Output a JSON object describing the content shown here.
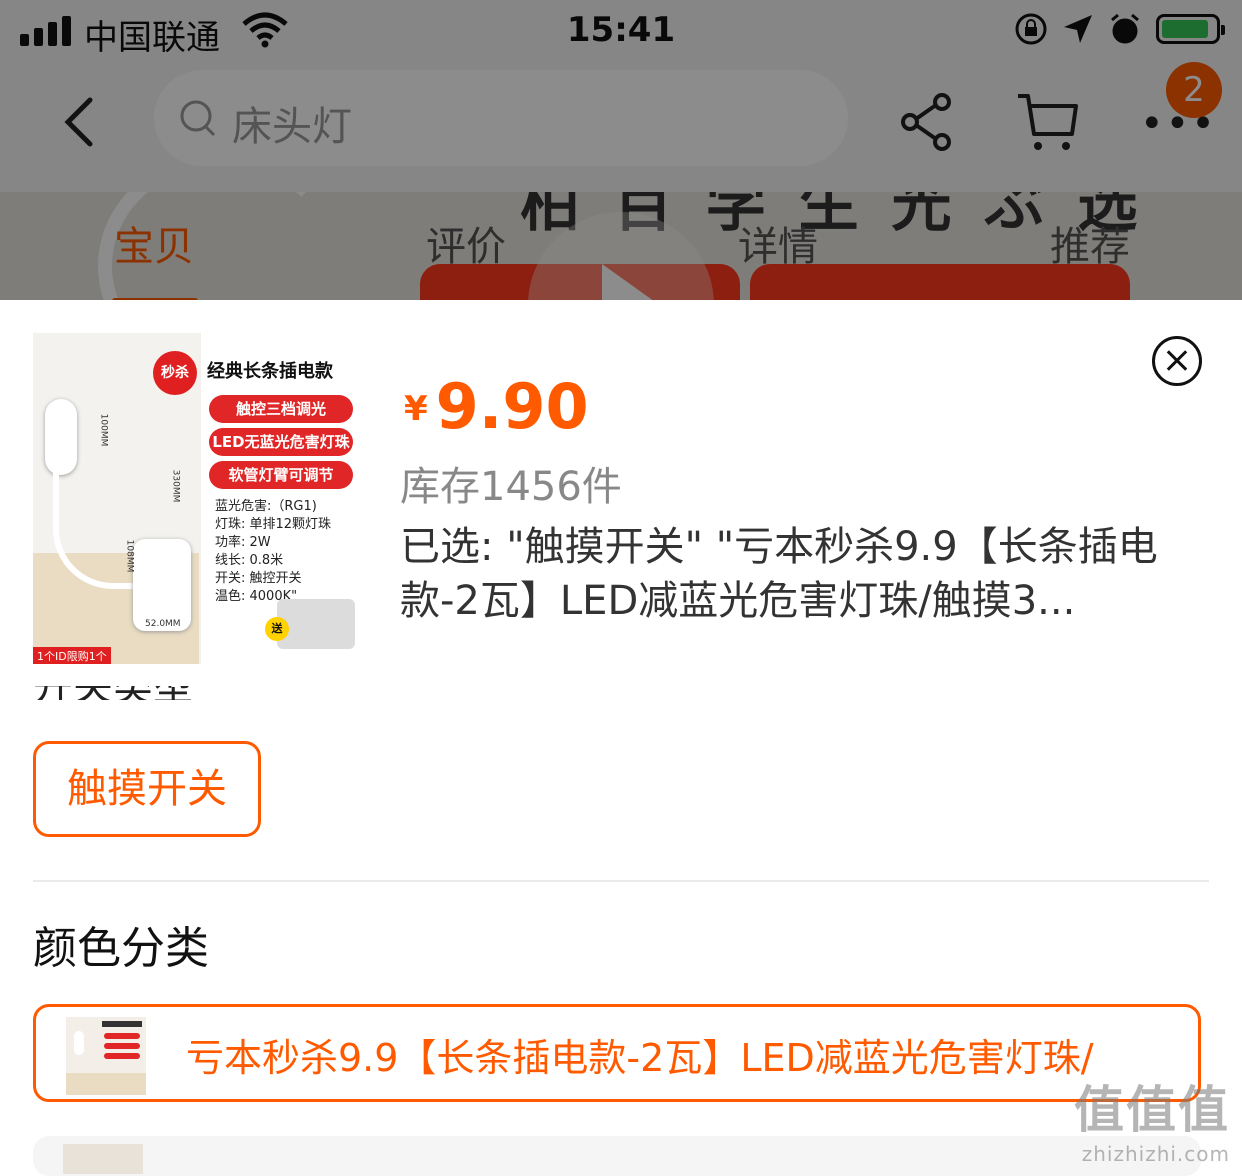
{
  "status_bar": {
    "carrier": "中国联通",
    "time": "15:41"
  },
  "nav": {
    "search_placeholder": "床头灯",
    "cart_badge": "2",
    "icons": [
      "back-arrow-icon",
      "search-icon",
      "share-icon",
      "cart-icon",
      "more-icon"
    ]
  },
  "tabs": [
    {
      "label": "宝贝",
      "active": true
    },
    {
      "label": "评价",
      "active": false
    },
    {
      "label": "详情",
      "active": false
    },
    {
      "label": "推荐",
      "active": false
    }
  ],
  "product_image": {
    "badge": "秒杀",
    "title": "经典长条插电款",
    "features": [
      "触控三档调光",
      "LED无蓝光危害灯珠",
      "软管灯臂可调节"
    ],
    "specs": [
      "蓝光危害:（RG1)",
      "灯珠: 单排12颗灯珠",
      "功率: 2W",
      "线长: 0.8米",
      "开关: 触控开关",
      "温色: 4000K\""
    ],
    "dimensions": [
      "100MM",
      "330MM",
      "108MM",
      "52.0MM"
    ],
    "gift_tag": "送",
    "limit_note": "1个ID限购1个"
  },
  "sku": {
    "currency": "¥",
    "price": "9.90",
    "stock": "库存1456件",
    "selected": "已选: \"触摸开关\" \"亏本秒杀9.9【长条插电款-2瓦】LED减蓝光危害灯珠/触摸3...",
    "switch_option": "触摸开关",
    "color_section_title": "颜色分类",
    "color_option": "亏本秒杀9.9【长条插电款-2瓦】LED减蓝光危害灯珠/"
  },
  "watermark": {
    "logo": "值值值",
    "url": "zhizhizhi.com"
  },
  "colors": {
    "accent": "#ff5a00",
    "badge": "#ff5a00",
    "promo_red": "#e02020"
  }
}
